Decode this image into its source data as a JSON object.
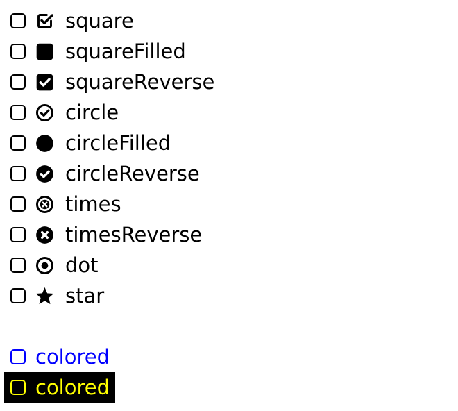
{
  "options": [
    {
      "label": "square",
      "icon": "square-check-icon"
    },
    {
      "label": "squareFilled",
      "icon": "square-filled-icon"
    },
    {
      "label": "squareReverse",
      "icon": "square-reverse-check-icon"
    },
    {
      "label": "circle",
      "icon": "circle-check-icon"
    },
    {
      "label": "circleFilled",
      "icon": "circle-filled-icon"
    },
    {
      "label": "circleReverse",
      "icon": "circle-reverse-check-icon"
    },
    {
      "label": "times",
      "icon": "circle-times-icon"
    },
    {
      "label": "timesReverse",
      "icon": "circle-times-reverse-icon"
    },
    {
      "label": "dot",
      "icon": "circle-dot-icon"
    },
    {
      "label": "star",
      "icon": "star-icon"
    }
  ],
  "colored": [
    {
      "label": "colored",
      "color": "#0000ff",
      "background": "#ffffff"
    },
    {
      "label": "colored",
      "color": "#ffff00",
      "background": "#000000"
    }
  ]
}
